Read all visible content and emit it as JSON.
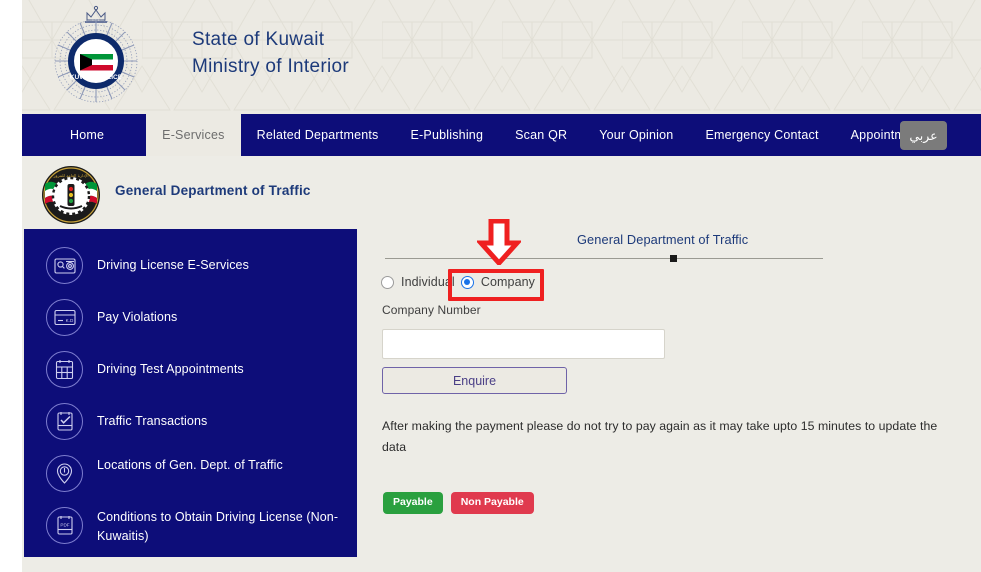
{
  "header": {
    "title_line1": "State of Kuwait",
    "title_line2": "Ministry of Interior",
    "crest_icon": "kuwait-police-crest-icon"
  },
  "nav": {
    "items": [
      {
        "label": "Home",
        "active": false
      },
      {
        "label": "E-Services",
        "active": true
      },
      {
        "label": "Related Departments",
        "active": false
      },
      {
        "label": "E-Publishing",
        "active": false
      },
      {
        "label": "Scan QR",
        "active": false
      },
      {
        "label": "Your Opinion",
        "active": false
      },
      {
        "label": "Emergency Contact",
        "active": false
      },
      {
        "label": "Appointments",
        "active": false
      }
    ],
    "language_button": "عربي"
  },
  "department": {
    "name": "General Department of Traffic",
    "logo_icon": "traffic-department-emblem-icon"
  },
  "sidebar": {
    "items": [
      {
        "label": "Driving License E-Services",
        "icon": "license-search-icon"
      },
      {
        "label": "Pay Violations",
        "icon": "payment-card-kd-icon"
      },
      {
        "label": "Driving Test Appointments",
        "icon": "calendar-icon"
      },
      {
        "label": "Traffic Transactions",
        "icon": "document-check-icon"
      },
      {
        "label": "Locations of Gen. Dept. of Traffic",
        "icon": "map-pin-icon"
      },
      {
        "label": "Conditions to Obtain Driving License (Non-Kuwaitis)",
        "icon": "pdf-document-icon"
      }
    ]
  },
  "main": {
    "heading": "General Department of Traffic",
    "radio_individual": "Individual",
    "radio_company": "Company",
    "selected_option": "Company",
    "field_label": "Company Number",
    "input_value": "",
    "input_placeholder": "",
    "enquire_button": "Enquire",
    "notice": "After making the payment please do not try to pay again as it may take upto 15 minutes to update the data",
    "badges": [
      {
        "label": "Payable",
        "color": "#2aa03f"
      },
      {
        "label": "Non Payable",
        "color": "#e03a4e"
      }
    ]
  },
  "annotations": {
    "arrow_color": "#ef2020",
    "highlight_color": "#ef2020",
    "arrow_target": "company-radio-option",
    "highlight_target": "company-radio-option"
  }
}
